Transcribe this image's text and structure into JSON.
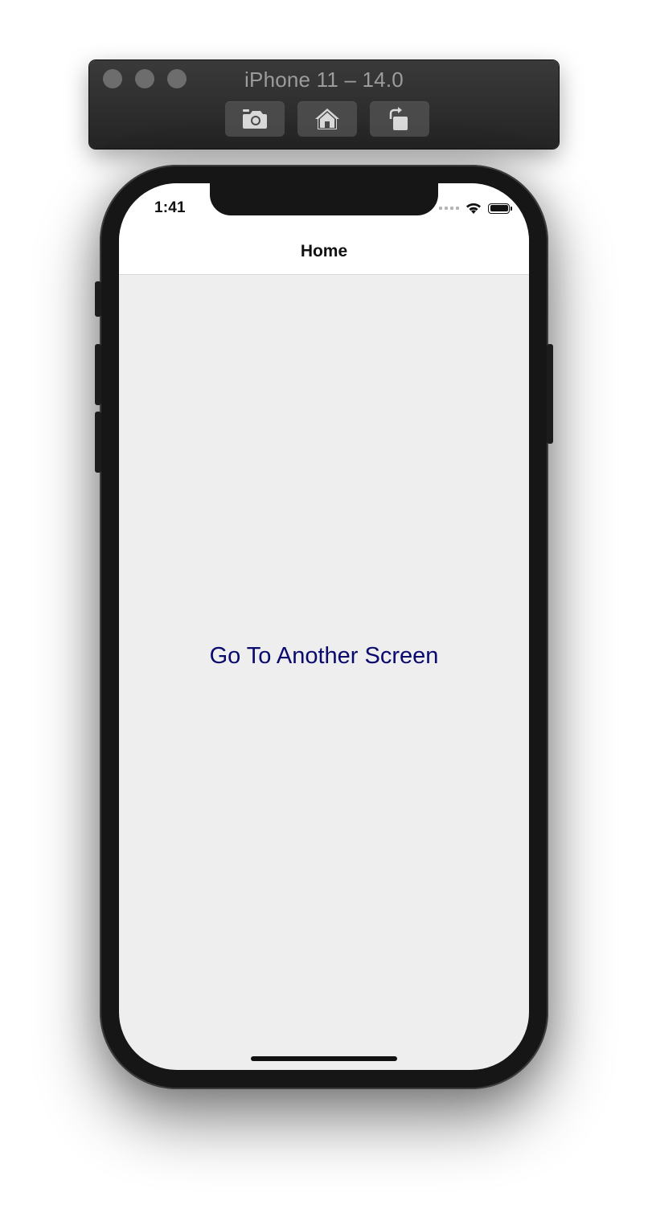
{
  "simulator": {
    "window_title": "iPhone 11 – 14.0",
    "buttons": [
      {
        "icon": "camera-icon",
        "label": "Screenshot"
      },
      {
        "icon": "home-icon",
        "label": "Home"
      },
      {
        "icon": "rotate-icon",
        "label": "Rotate"
      }
    ]
  },
  "status_bar": {
    "time": "1:41",
    "icons": [
      "signal-dots-icon",
      "wifi-icon",
      "battery-icon"
    ]
  },
  "nav": {
    "title": "Home"
  },
  "main": {
    "link_label": "Go To Another Screen"
  },
  "colors": {
    "link": "#0a0a6e",
    "screen_background": "#eeeeee",
    "header_background": "#ffffff"
  }
}
